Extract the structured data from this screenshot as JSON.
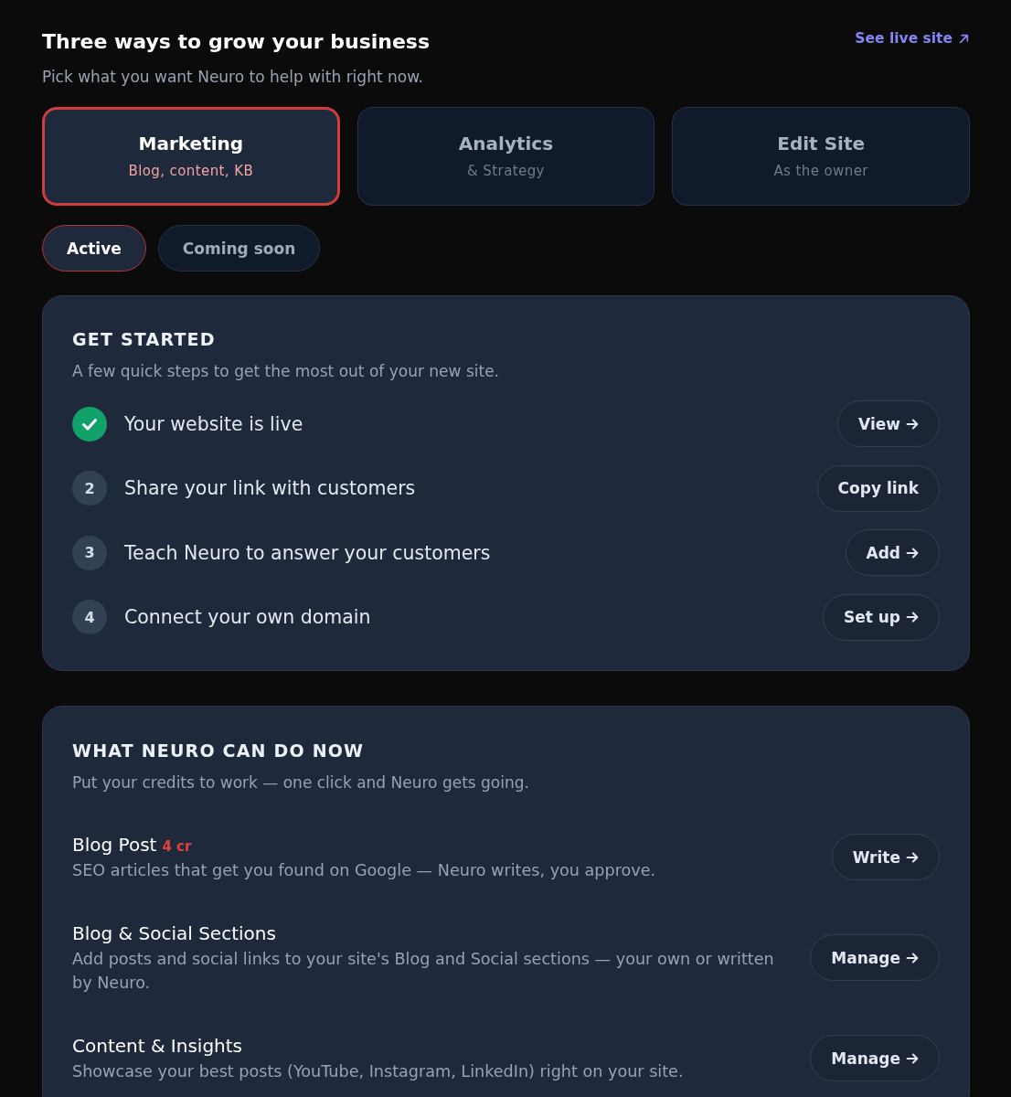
{
  "header": {
    "title": "Three ways to grow your business",
    "subtitle": "Pick what you want Neuro to help with right now.",
    "link": "See live site"
  },
  "tabs": [
    {
      "title": "Marketing",
      "subtitle": "Blog, content, KB",
      "selected": true
    },
    {
      "title": "Analytics",
      "subtitle": "& Strategy",
      "selected": false
    },
    {
      "title": "Edit Site",
      "subtitle": "As the owner",
      "selected": false
    }
  ],
  "filters": [
    {
      "label": "Active",
      "selected": true
    },
    {
      "label": "Coming soon",
      "selected": false
    }
  ],
  "get_started": {
    "title": "GET STARTED",
    "subtitle": "A few quick steps to get the most out of your new site.",
    "steps": [
      {
        "done": true,
        "text": "Your website is live",
        "action": {
          "label": "View",
          "arrow": true
        }
      },
      {
        "done": false,
        "number": "2",
        "text": "Share your link with customers",
        "action": {
          "label": "Copy link",
          "arrow": false
        }
      },
      {
        "done": false,
        "number": "3",
        "text": "Teach Neuro to answer your customers",
        "action": {
          "label": "Add",
          "arrow": true
        }
      },
      {
        "done": false,
        "number": "4",
        "text": "Connect your own domain",
        "action": {
          "label": "Set up",
          "arrow": true
        }
      }
    ]
  },
  "capabilities": {
    "title": "WHAT NEURO CAN DO NOW",
    "subtitle": "Put your credits to work — one click and Neuro gets going.",
    "items": [
      {
        "title": "Blog Post",
        "credits": "4 cr",
        "description": "SEO articles that get you found on Google — Neuro writes, you approve.",
        "action": {
          "label": "Write",
          "arrow": true
        }
      },
      {
        "title": "Blog & Social Sections",
        "description": "Add posts and social links to your site's Blog and Social sections — your own or written by Neuro.",
        "action": {
          "label": "Manage",
          "arrow": true
        }
      },
      {
        "title": "Content & Insights",
        "description": "Showcase your best posts (YouTube, Instagram, LinkedIn) right on your site.",
        "action": {
          "label": "Manage",
          "arrow": true
        }
      }
    ]
  }
}
